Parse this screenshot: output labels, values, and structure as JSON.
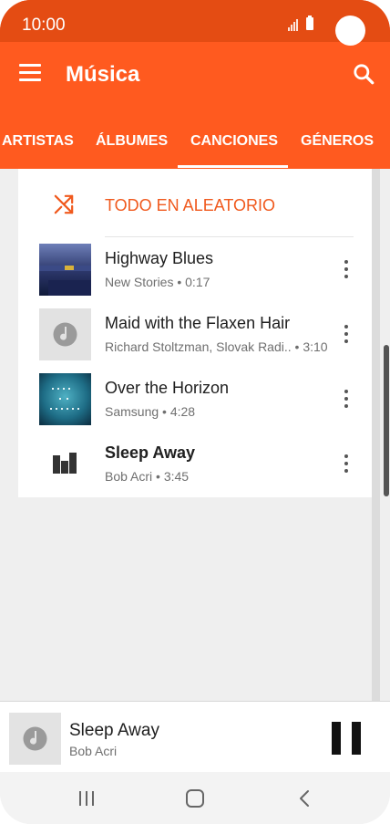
{
  "status_bar": {
    "time": "10:00"
  },
  "app_bar": {
    "title": "Música"
  },
  "tabs": [
    {
      "label": "ARTISTAS"
    },
    {
      "label": "ÁLBUMES"
    },
    {
      "label": "CANCIONES",
      "selected": true
    },
    {
      "label": "GÉNEROS"
    }
  ],
  "shuffle": {
    "label": "TODO EN ALEATORIO"
  },
  "songs": [
    {
      "title": "Highway Blues",
      "meta": "New Stories • 0:17"
    },
    {
      "title": "Maid with the Flaxen Hair",
      "meta": "Richard Stoltzman, Slovak Radi..  • 3:10"
    },
    {
      "title": "Over the Horizon",
      "meta": "Samsung • 4:28"
    },
    {
      "title": "Sleep Away",
      "meta": "Bob Acri • 3:45",
      "playing": true
    }
  ],
  "now_playing": {
    "title": "Sleep Away",
    "artist": "Bob Acri"
  },
  "colors": {
    "accent": "#ff5a1f",
    "status_bar": "#e44c13",
    "shuffle_text": "#f0591d"
  },
  "icons": {
    "menu": "hamburger-icon",
    "search": "search-icon",
    "shuffle": "shuffle-icon",
    "more": "more-vertical-icon",
    "note": "music-note-icon",
    "equalizer": "equalizer-icon",
    "pause": "pause-icon",
    "recents": "recents-icon",
    "home": "home-icon",
    "back": "back-icon"
  }
}
